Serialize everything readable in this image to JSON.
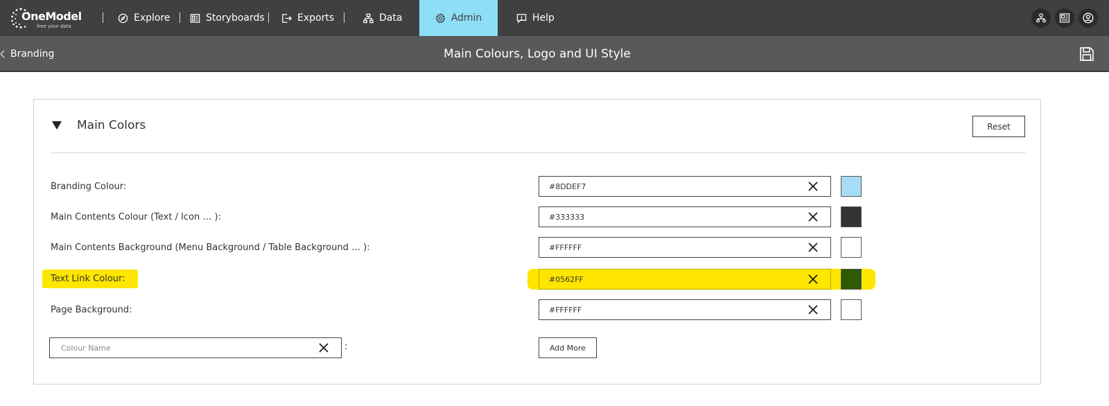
{
  "logo": {
    "brand": "OneModel",
    "tagline": "free your data"
  },
  "nav": {
    "explore": "Explore",
    "storyboards": "Storyboards",
    "exports": "Exports",
    "data": "Data",
    "admin": "Admin",
    "help": "Help"
  },
  "subheader": {
    "back_label": "Branding",
    "title": "Main Colours, Logo and UI Style"
  },
  "section": {
    "title": "Main Colors",
    "reset_label": "Reset"
  },
  "rows": [
    {
      "label": "Branding Colour:",
      "value": "#8DDEF7",
      "swatch": "#A7DCF7"
    },
    {
      "label": "Main Contents Colour (Text / Icon … ):",
      "value": "#333333",
      "swatch": "#333333"
    },
    {
      "label": "Main Contents Background (Menu Background / Table Background … ):",
      "value": "#FFFFFF",
      "swatch": "#FFFFFF"
    },
    {
      "label": "Text Link Colour:",
      "value": "#0562FF",
      "swatch": "#2E5A00"
    },
    {
      "label": "Page Background:",
      "value": "#FFFFFF",
      "swatch": "#FFFFFF"
    }
  ],
  "new_colour": {
    "placeholder": "Colour Name",
    "colon": ":",
    "add_label": "Add More"
  },
  "colors": {
    "topbar": "#404040",
    "subbar": "#595959",
    "accent": "#8DDEF7",
    "highlight": "#FFE600"
  }
}
